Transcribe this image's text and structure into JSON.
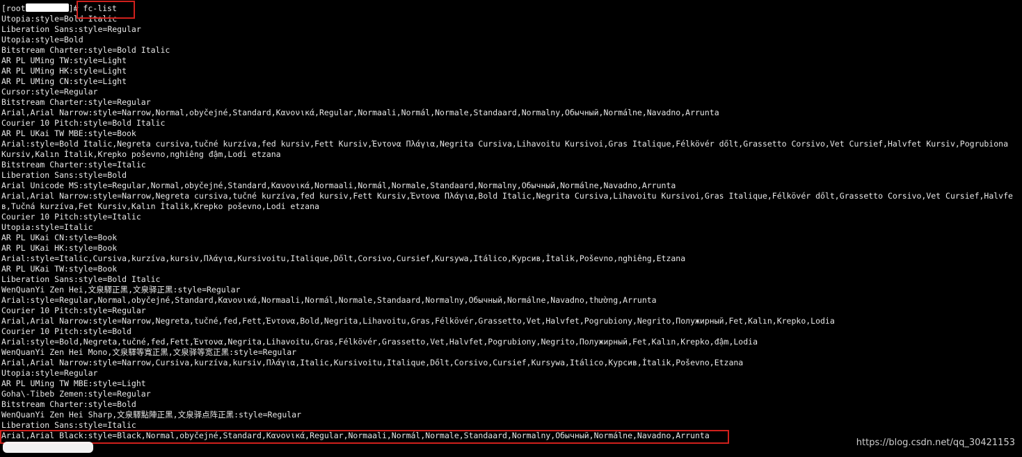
{
  "terminal": {
    "prompt_user": "[root",
    "prompt_suffix": "]#",
    "command": "fc-list",
    "lines": [
      "Utopia:style=Bold Italic",
      "Liberation Sans:style=Regular",
      "Utopia:style=Bold",
      "Bitstream Charter:style=Bold Italic",
      "AR PL UMing TW:style=Light",
      "AR PL UMing HK:style=Light",
      "AR PL UMing CN:style=Light",
      "Cursor:style=Regular",
      "Bitstream Charter:style=Regular",
      "Arial,Arial Narrow:style=Narrow,Normal,obyčejné,Standard,Κανονικά,Regular,Normaali,Normál,Normale,Standaard,Normalny,Обычный,Normálne,Navadno,Arrunta",
      "Courier 10 Pitch:style=Bold Italic",
      "AR PL UKai TW MBE:style=Book",
      "Arial:style=Bold Italic,Negreta cursiva,tučné kurzíva,fed kursiv,Fett Kursiv,Έντονα Πλάγια,Negrita Cursiva,Lihavoitu Kursivoi,Gras Italique,Félkövér dőlt,Grassetto Corsivo,Vet Cursief,Halvfet Kursiv,Pogrubiona",
      "Kursiv,Kalın İtalik,Krepko poševno,nghiêng đậm,Lodi etzana",
      "Bitstream Charter:style=Italic",
      "Liberation Sans:style=Bold",
      "Arial Unicode MS:style=Regular,Normal,obyčejné,Standard,Κανονικά,Normaali,Normál,Normale,Standaard,Normalny,Обычный,Normálne,Navadno,Arrunta",
      "Arial,Arial Narrow:style=Narrow,Negreta cursiva,tučné kurzíva,fed kursiv,Fett Kursiv,Έντονα Πλάγια,Bold Italic,Negrita Cursiva,Lihavoitu Kursivoi,Gras Italique,Félkövér dőlt,Grassetto Corsivo,Vet Cursief,Halvfe",
      "в,Tučná kurzíva,Fet Kursiv,Kalın İtalik,Krepko poševno,Lodi etzana",
      "Courier 10 Pitch:style=Italic",
      "Utopia:style=Italic",
      "AR PL UKai CN:style=Book",
      "AR PL UKai HK:style=Book",
      "Arial:style=Italic,Cursiva,kurzíva,kursiv,Πλάγια,Kursivoitu,Italique,Dőlt,Corsivo,Cursief,Kursywa,Itálico,Курсив,İtalik,Poševno,nghiêng,Etzana",
      "AR PL UKai TW:style=Book",
      "Liberation Sans:style=Bold Italic",
      "WenQuanYi Zen Hei,文泉驛正黑,文泉驿正黑:style=Regular",
      "Arial:style=Regular,Normal,obyčejné,Standard,Κανονικά,Normaali,Normál,Normale,Standaard,Normalny,Обычный,Normálne,Navadno,thường,Arrunta",
      "Courier 10 Pitch:style=Regular",
      "Arial,Arial Narrow:style=Narrow,Negreta,tučné,fed,Fett,Έντονα,Bold,Negrita,Lihavoitu,Gras,Félkövér,Grassetto,Vet,Halvfet,Pogrubiony,Negrito,Полужирный,Fet,Kalın,Krepko,Lodia",
      "Courier 10 Pitch:style=Bold",
      "Arial:style=Bold,Negreta,tučné,fed,Fett,Έντονα,Negrita,Lihavoitu,Gras,Félkövér,Grassetto,Vet,Halvfet,Pogrubiony,Negrito,Полужирный,Fet,Kalın,Krepko,đậm,Lodia",
      "WenQuanYi Zen Hei Mono,文泉驛等寬正黑,文泉驿等宽正黑:style=Regular",
      "Arial,Arial Narrow:style=Narrow,Cursiva,kurzíva,kursiv,Πλάγια,Italic,Kursivoitu,Italique,Dőlt,Corsivo,Cursief,Kursywa,Itálico,Курсив,İtalik,Poševno,Etzana",
      "Utopia:style=Regular",
      "AR PL UMing TW MBE:style=Light",
      "Goha\\-Tibeb Zemen:style=Regular",
      "Bitstream Charter:style=Bold",
      "WenQuanYi Zen Hei Sharp,文泉驛點陣正黑,文泉驿点阵正黑:style=Regular",
      "Liberation Sans:style=Italic",
      "Arial,Arial Black:style=Black,Normal,obyčejné,Standard,Κανονικά,Regular,Normaali,Normál,Normale,Standaard,Normalny,Обычный,Normálne,Navadno,Arrunta"
    ]
  },
  "watermark": "https://blog.csdn.net/qq_30421153",
  "colors": {
    "background": "#000000",
    "text": "#e8e8e8",
    "highlight_box": "#d0201c"
  }
}
